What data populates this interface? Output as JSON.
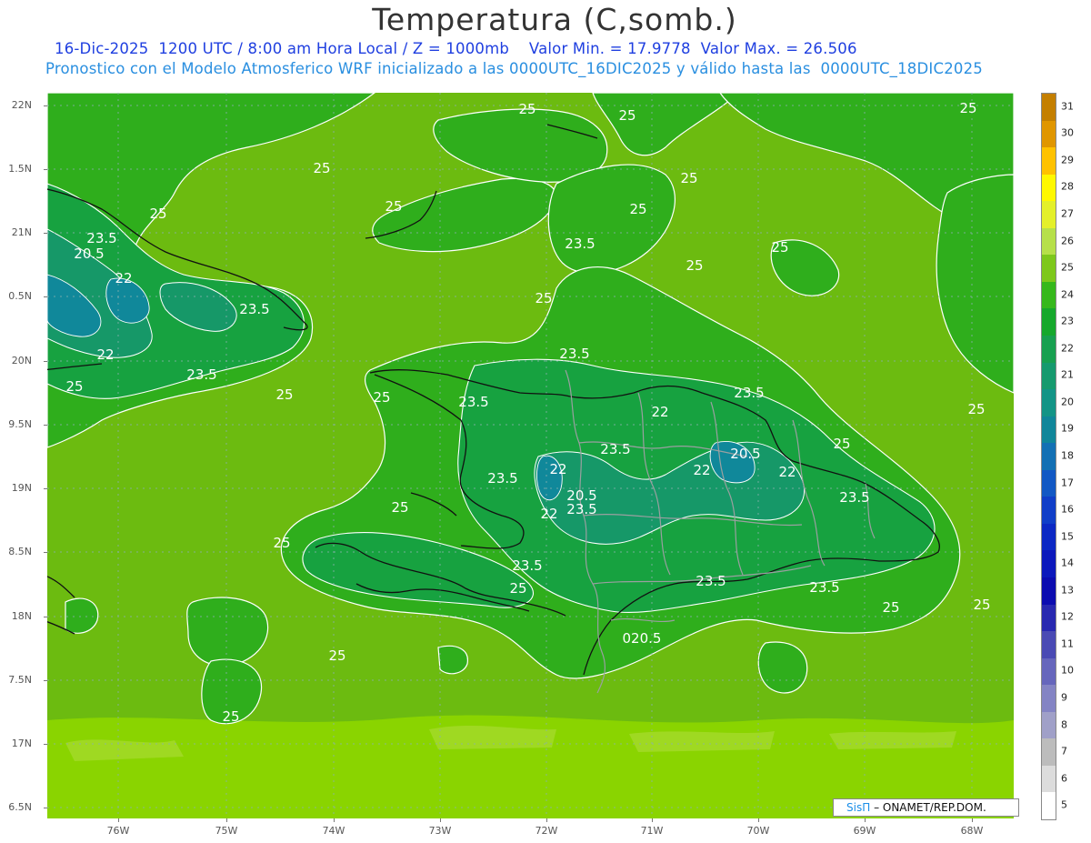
{
  "header": {
    "title": "Temperatura (C,somb.)",
    "line1": "16-Dic-2025  1200 UTC / 8:00 am Hora Local / Z = 1000mb    Valor Min. = 17.9778  Valor Max. = 26.506",
    "line2": "Pronostico con el Modelo Atmosferico WRF inicializado a las 0000UTC_16DIC2025 y válido hasta las  0000UTC_18DIC2025"
  },
  "map": {
    "lat_labels": [
      "22N",
      "1.5N",
      "21N",
      "0.5N",
      "20N",
      "9.5N",
      "19N",
      "8.5N",
      "18N",
      "7.5N",
      "17N",
      "6.5N"
    ],
    "lon_labels": [
      "76W",
      "75W",
      "74W",
      "73W",
      "72W",
      "71W",
      "70W",
      "69W",
      "68W"
    ],
    "contour_labels": [
      "25",
      "25",
      "25",
      "25",
      "25",
      "25",
      "25",
      "25",
      "25",
      "25",
      "25",
      "25",
      "25",
      "25",
      "25",
      "25",
      "25",
      "25",
      "25",
      "25",
      "25",
      "25",
      "25",
      "23.5",
      "23.5",
      "23.5",
      "23.5",
      "23.5",
      "23.5",
      "23.5",
      "23.5",
      "23.5",
      "23.5",
      "23.5",
      "23.5",
      "23.5",
      "23.5",
      "22",
      "22",
      "22",
      "22",
      "22",
      "22",
      "22",
      "20.5",
      "20.5",
      "20.5",
      "020.5"
    ]
  },
  "legend": {
    "values": [
      "31",
      "30",
      "29",
      "28",
      "27",
      "26",
      "25",
      "24",
      "23",
      "22",
      "21",
      "20",
      "19",
      "18",
      "17",
      "16",
      "15",
      "14",
      "13",
      "12",
      "11",
      "10",
      "9",
      "8",
      "7",
      "6",
      "5"
    ],
    "colors": [
      "#c47f00",
      "#e09600",
      "#ffc200",
      "#fff800",
      "#e4f02a",
      "#b6e04a",
      "#7ec81c",
      "#36b81c",
      "#16a82c",
      "#18a050",
      "#169a6e",
      "#139486",
      "#10869a",
      "#1370b4",
      "#1258c4",
      "#103ec8",
      "#0c28c4",
      "#0c18bc",
      "#0c0cb0",
      "#2828b0",
      "#4a4ab4",
      "#6666bc",
      "#8484c4",
      "#a0a0c8",
      "#bcbcbc",
      "#dcdcdc",
      "#ffffff"
    ]
  },
  "credit": {
    "brand": "SisΠ",
    "text": "– ONAMET/REP.DOM."
  }
}
